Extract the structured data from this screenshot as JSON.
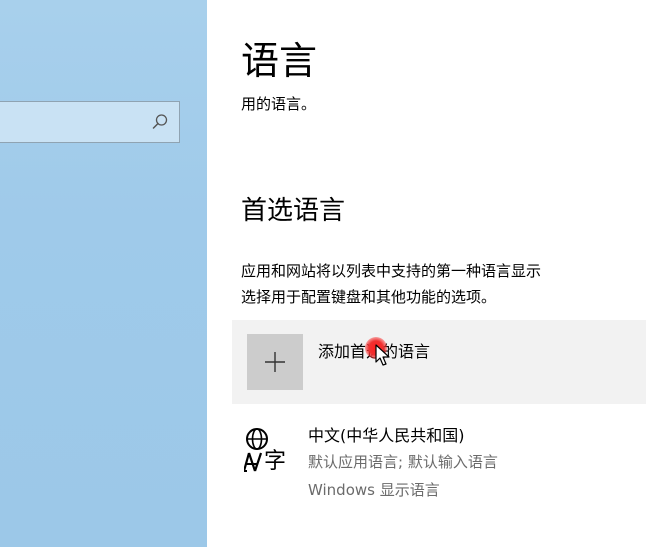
{
  "left_pane": {
    "search": {
      "value": "",
      "placeholder": ""
    },
    "search_icon": "search-icon"
  },
  "header": {
    "title": "语言",
    "description": "用的语言。"
  },
  "preferred_languages": {
    "title": "首选语言",
    "description_line1": "应用和网站将以列表中支持的第一种语言显示",
    "description_line2": "选择用于配置键盘和其他功能的选项。",
    "add_button": {
      "icon": "plus-icon",
      "label": "添加首选的语言"
    },
    "languages": [
      {
        "icon": "language-icon",
        "name": "中文(中华人民共和国)",
        "detail_line1": "默认应用语言; 默认输入语言",
        "detail_line2": "Windows 显示语言"
      }
    ]
  },
  "colors": {
    "left_pane_bg": "#9fcaea",
    "search_bg": "#c9e2f4",
    "add_row_bg": "#f2f2f2",
    "add_plus_bg": "#cccccc",
    "secondary_text": "#6b6b6b",
    "cursor_highlight": "#ff2020"
  }
}
